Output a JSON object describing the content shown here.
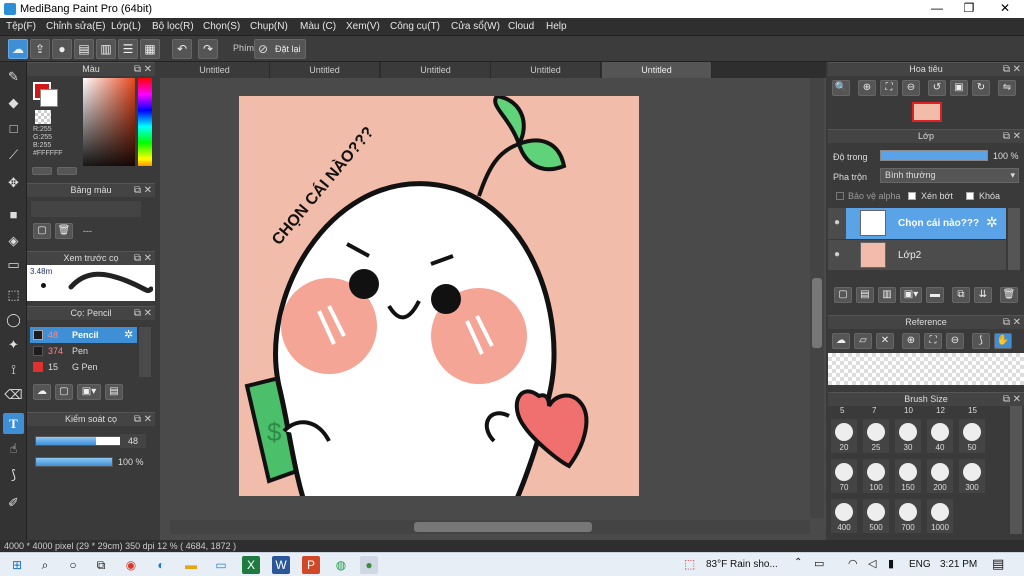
{
  "window": {
    "title": "MediBang Paint Pro (64bit)",
    "minimize": "—",
    "maximize": "❐",
    "close": "✕"
  },
  "menu": [
    "Tệp(F)",
    "Chỉnh sửa(E)",
    "Lớp(L)",
    "Bộ lọc(R)",
    "Chọn(S)",
    "Chụp(N)",
    "Màu (C)",
    "Xem(V)",
    "Công cụ(T)",
    "Cửa sổ(W)",
    "Cloud",
    "Help"
  ],
  "toolbar": {
    "shortcut_label": "Phím",
    "undo_label": "Đặt lại"
  },
  "doc_tabs": [
    "Untitled",
    "Untitled",
    "Untitled",
    "Untitled",
    "Untitled"
  ],
  "color_panel": {
    "title": "Màu",
    "r": "R:255",
    "g": "G:255",
    "b": "B:255",
    "hex": "#FFFFFF"
  },
  "palette_panel": {
    "title": "Bảng màu",
    "value": "---"
  },
  "brush_preview": {
    "title": "Xem trước cọ",
    "size": "3.48m"
  },
  "brush_panel": {
    "title": "Cọ: Pencil",
    "items": [
      {
        "size": "48",
        "name": "Pencil",
        "color": "#1d1d1d"
      },
      {
        "size": "374",
        "name": "Pen",
        "color": "#1d1d1d"
      },
      {
        "size": "15",
        "name": "G Pen",
        "color": "#e03030"
      }
    ]
  },
  "brush_control": {
    "title": "Kiểm soát cọ",
    "size_value": "48",
    "opacity_value": "100 %",
    "size_fraction": 0.72,
    "opacity_fraction": 1.0
  },
  "navigator": {
    "title": "Hoa tiêu"
  },
  "layer_panel": {
    "title": "Lớp",
    "opacity_label": "Độ trong",
    "opacity_value": "100 %",
    "blend_label": "Pha trộn",
    "blend_value": "Bình thường",
    "protect_alpha": "Bảo vệ alpha",
    "clipping": "Xén bớt",
    "lock": "Khóa",
    "layers": [
      {
        "name": "Chọn cái nào???",
        "selected": true
      },
      {
        "name": "Lớp2",
        "selected": false
      }
    ]
  },
  "reference_panel": {
    "title": "Reference"
  },
  "brush_size_panel": {
    "title": "Brush Size",
    "header_sizes": [
      "5",
      "7",
      "10",
      "12",
      "15"
    ],
    "sizes": [
      "20",
      "25",
      "30",
      "40",
      "50",
      "70",
      "100",
      "150",
      "200",
      "300",
      "400",
      "500",
      "700",
      "1000"
    ]
  },
  "canvas": {
    "text": "CHỌN CÁI NÀO???"
  },
  "status": {
    "text": "4000 * 4000 pixel   (29 * 29cm)   350 dpi   12 %   ( 4684, 1872 )"
  },
  "taskbar": {
    "weather": "83°F  Rain sho...",
    "lang": "ENG",
    "time": "3:21 PM"
  },
  "colors": {
    "accent": "#3f8fd6",
    "canvas_bg": "#f1bcaa",
    "app_bg": "#3a3a3a"
  }
}
